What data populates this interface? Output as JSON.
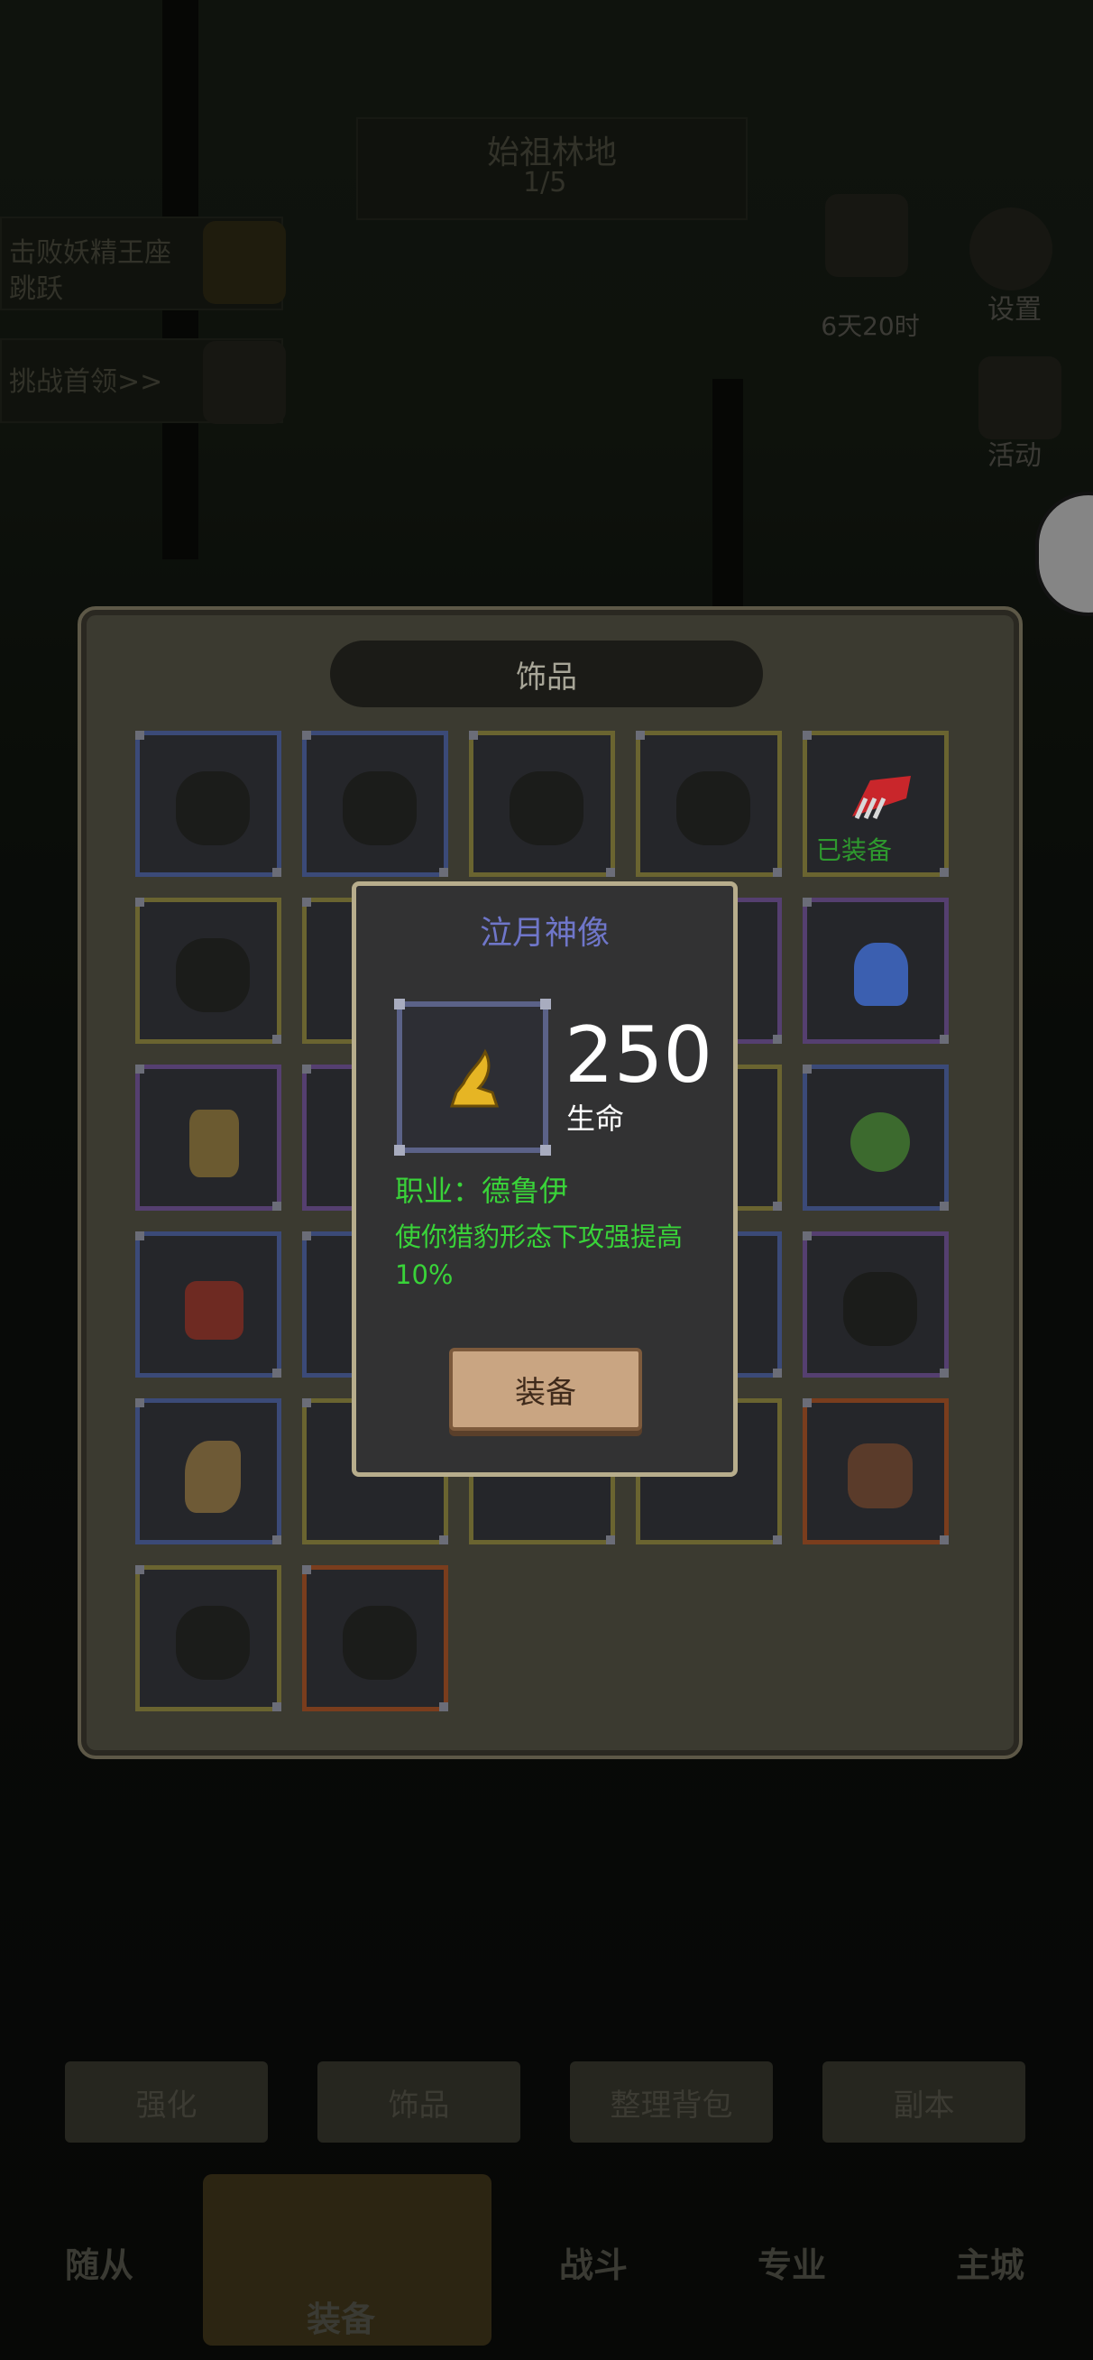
{
  "background": {
    "zone_title": "始祖林地",
    "zone_progress": "1/5",
    "quest_1": "击败妖精王座",
    "quest_2": "跳跃",
    "quest_3": "挑战首领>>",
    "hud_top_right": "设置",
    "hud_time": "6天20时",
    "hud_activity": "活动",
    "bottom_buttons": [
      "强化",
      "饰品",
      "整理背包",
      "副本"
    ],
    "bottom_nav": [
      "随从",
      "装备",
      "战斗",
      "专业",
      "主城"
    ]
  },
  "panel": {
    "title": "饰品",
    "equipped_label": "已装备"
  },
  "popup": {
    "item_name": "泣月神像",
    "stat_value": "250",
    "stat_label": "生命",
    "class_line": "职业：德鲁伊",
    "description": "使你猎豹形态下攻强提高10%",
    "equip_button": "装备"
  },
  "colors": {
    "title_color": "#6f76c9",
    "effect_color": "#39d339",
    "popup_border": "#b7ad8c"
  }
}
